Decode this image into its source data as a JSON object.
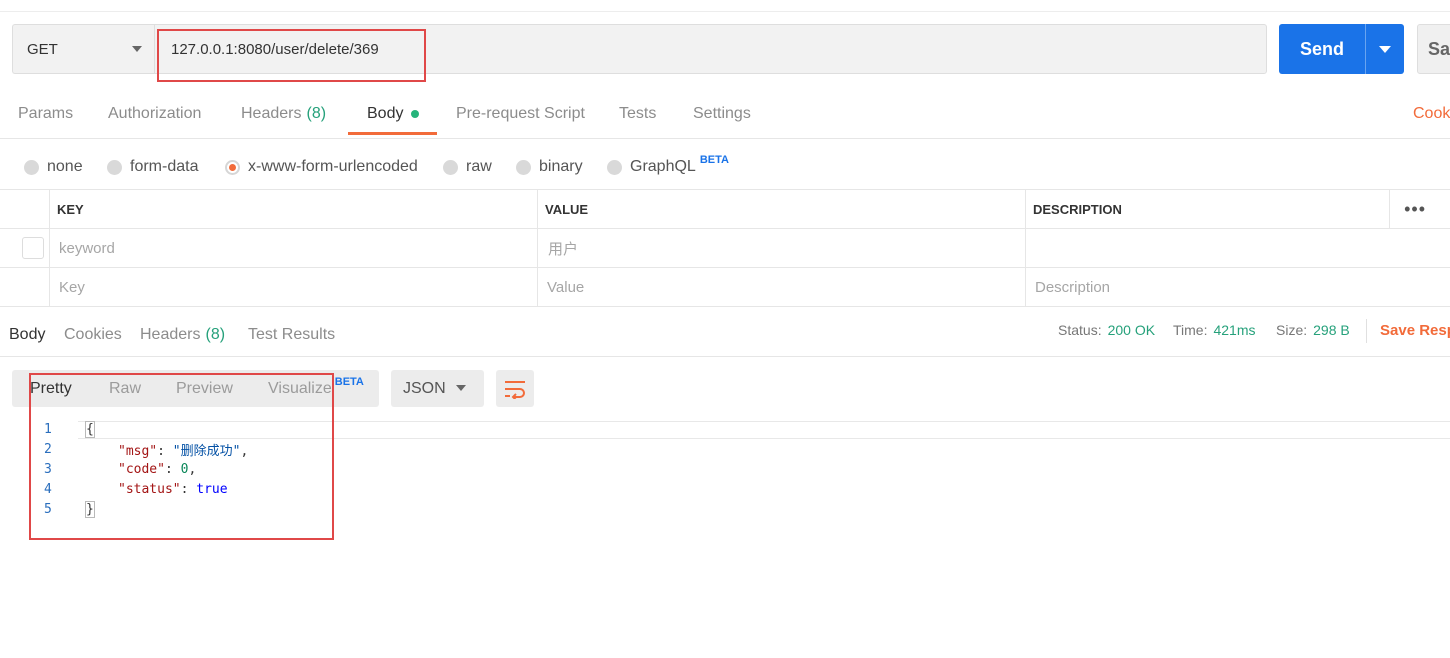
{
  "request": {
    "method": "GET",
    "url": "127.0.0.1:8080/user/delete/369",
    "send_label": "Send",
    "save_label": "Sav"
  },
  "request_tabs": [
    {
      "label": "Params"
    },
    {
      "label": "Authorization"
    },
    {
      "label": "Headers",
      "count": "(8)"
    },
    {
      "label": "Body"
    },
    {
      "label": "Pre-request Script"
    },
    {
      "label": "Tests"
    },
    {
      "label": "Settings"
    }
  ],
  "cookies_link": "Cook",
  "body_types": [
    {
      "label": "none"
    },
    {
      "label": "form-data"
    },
    {
      "label": "x-www-form-urlencoded",
      "selected": true
    },
    {
      "label": "raw"
    },
    {
      "label": "binary"
    },
    {
      "label": "GraphQL",
      "badge": "BETA"
    }
  ],
  "kv_table": {
    "headers": {
      "key": "KEY",
      "value": "VALUE",
      "description": "DESCRIPTION"
    },
    "more": "•••",
    "rows": [
      {
        "key": "keyword",
        "value": "用户",
        "description": ""
      }
    ],
    "placeholder": {
      "key": "Key",
      "value": "Value",
      "description": "Description"
    }
  },
  "response": {
    "tabs": [
      {
        "label": "Body"
      },
      {
        "label": "Cookies"
      },
      {
        "label": "Headers",
        "count": "(8)"
      },
      {
        "label": "Test Results"
      }
    ],
    "status_label": "Status:",
    "status_value": "200 OK",
    "time_label": "Time:",
    "time_value": "421ms",
    "size_label": "Size:",
    "size_value": "298 B",
    "save_label": "Save Resp"
  },
  "view": {
    "modes": [
      "Pretty",
      "Raw",
      "Preview",
      "Visualize"
    ],
    "visualize_badge": "BETA",
    "format": "JSON"
  },
  "code": {
    "line_numbers": [
      "1",
      "2",
      "3",
      "4",
      "5"
    ],
    "open": "{",
    "close": "}",
    "msg_key": "\"msg\"",
    "msg_value": "\"删除成功\"",
    "code_key": "\"code\"",
    "code_value": "0",
    "status_key": "\"status\"",
    "status_value": "true"
  },
  "colors": {
    "accent": "#f26b3a",
    "send": "#1a73e8",
    "ok": "#26a17b",
    "highlight_box": "#e04848"
  }
}
